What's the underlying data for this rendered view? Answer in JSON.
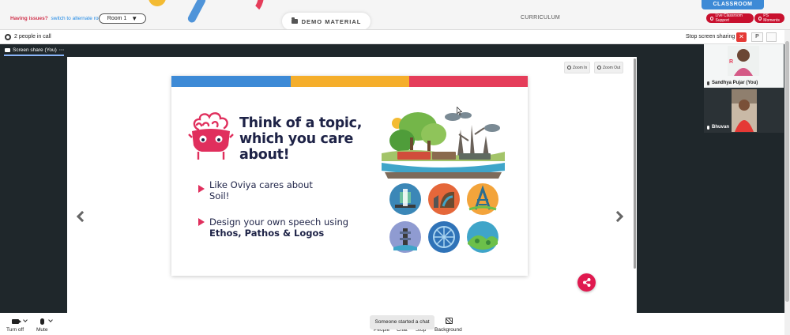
{
  "topbar": {
    "issues_text": "Having issues?",
    "switch_link": "switch to alternate room",
    "room_select": "Room 1",
    "demo_tab": "DEMO MATERIAL",
    "curriculum_tab": "CURRICULUM",
    "classroom_badge": "CLASSROOM",
    "support_button": "Live Classroom Support",
    "moments_button": "PS Moments"
  },
  "call": {
    "people_count": "2 people in call",
    "stop_sharing": "Stop screen sharing",
    "close_symbol": "✕",
    "p_button": "P",
    "share_label": "Screen share (You)",
    "more_symbol": "⋯"
  },
  "viewer": {
    "zoom_in": "Zoom In",
    "zoom_out": "Zoom Out"
  },
  "slide": {
    "title": "Think of a topic, which you care about!",
    "bullets": [
      {
        "text": "Like Oviya cares about Soil!"
      },
      {
        "line1": "Design your own speech using",
        "line2": "Ethos, Pathos & Logos"
      }
    ]
  },
  "participants": [
    {
      "name": "Sandhya Pujar (You)"
    },
    {
      "name": "Bhuvan"
    }
  ],
  "bottombar": {
    "turn_off": "Turn off",
    "mute": "Mute",
    "toast": "Someone started a chat",
    "people": "People",
    "chat": "Chat",
    "stop": "Stop",
    "background": "Background"
  },
  "colors": {
    "band_blue": "#3d8ad6",
    "band_yellow": "#f5ae2b",
    "band_red": "#e53d5a",
    "accent_pink": "#e0194f",
    "title_navy": "#1e2347"
  }
}
